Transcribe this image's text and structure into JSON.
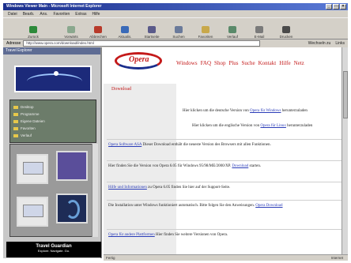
{
  "window": {
    "title": "Windows Viewer Main - Microsoft Internet Explorer"
  },
  "menu": [
    "Datei",
    "Bearb.",
    "Ans.",
    "Favoriten",
    "Extras",
    "Hilfe"
  ],
  "toolbar": [
    {
      "label": "Zurück",
      "icon": "back-arrow-icon"
    },
    {
      "label": "Vorwärts",
      "icon": "forward-arrow-icon"
    },
    {
      "label": "Abbrechen",
      "icon": "stop-icon"
    },
    {
      "label": "Aktualis.",
      "icon": "refresh-icon"
    },
    {
      "label": "Startseite",
      "icon": "home-icon"
    },
    {
      "label": "Suchen",
      "icon": "search-icon"
    },
    {
      "label": "Favoriten",
      "icon": "favorites-icon"
    },
    {
      "label": "Verlauf",
      "icon": "history-icon"
    },
    {
      "label": "E-Mail",
      "icon": "mail-icon"
    },
    {
      "label": "Drucken",
      "icon": "print-icon"
    }
  ],
  "address": {
    "label": "Adresse",
    "value": "http://www.opera.com/download/index.html",
    "links_label": "Links",
    "go_label": "Wechseln zu"
  },
  "sidebar": {
    "header": "Travel Explorer",
    "tree_items": [
      "Desktop",
      "Programme",
      "Eigene Dateien",
      "Favoriten",
      "Verlauf"
    ],
    "footer_title": "Travel Guardian",
    "footer_sub": "Explore. Navigate. Go."
  },
  "content": {
    "logo_text": "Opera",
    "nav": [
      "Windows",
      "FAQ",
      "Shop",
      "Plus",
      "Suche",
      "Kontakt",
      "Hilfe",
      "Netz"
    ],
    "page_title": "Download",
    "rows": [
      {
        "text": "Hier klicken um die deutsche Version von ",
        "link": "Opera für Windows",
        "suffix": " herunterzuladen"
      },
      {
        "text": "Hier klicken um die englische Version von ",
        "link": "Opera für Linux",
        "suffix": " herunterzuladen"
      },
      {
        "link": "Opera Software ASA",
        "text": " Dieser Download enthält die neueste Version des Browsers mit allen Funktionen."
      },
      {
        "text": "Hier finden Sie die Version von Opera 6.05 für Windows 95/98/ME/2000/XP. ",
        "link": "Download",
        "suffix": " starten."
      },
      {
        "link": "Hilfe und Informationen",
        "text": " zu Opera 6.05 finden Sie hier auf der Support-Seite."
      },
      {
        "text": "Die Installation unter Windows funktioniert automatisch. Bitte folgen Sie den Anweisungen. ",
        "link": "Opera Download"
      },
      {
        "link": "Opera für andere Plattformen",
        "text": " Hier finden Sie weitere Versionen von Opera."
      }
    ]
  },
  "status": {
    "left": "Fertig",
    "right": "Internet"
  }
}
